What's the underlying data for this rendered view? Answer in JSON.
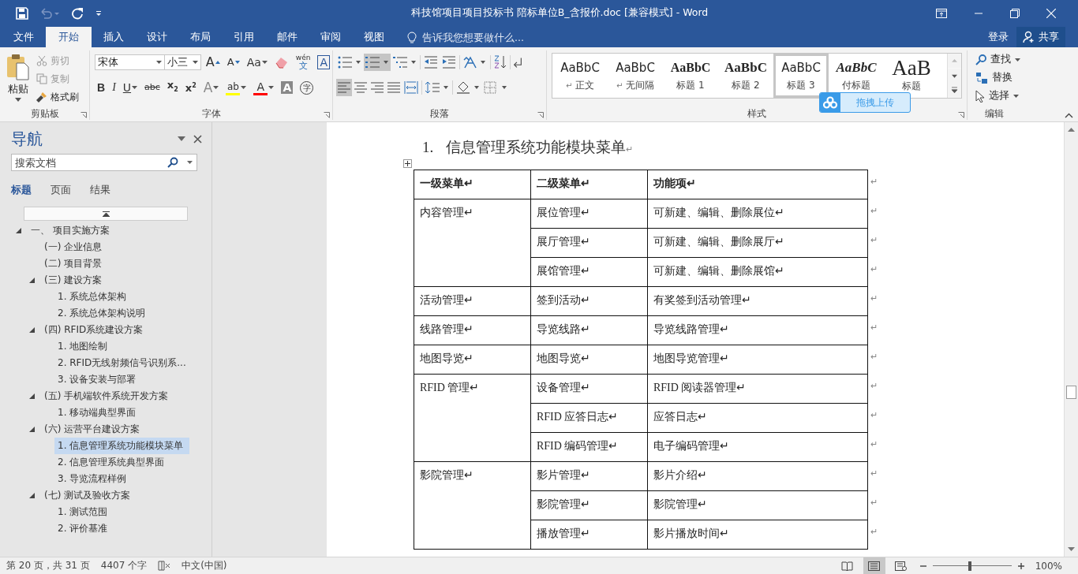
{
  "window": {
    "title": "科技馆项目项目投标书 陪标单位B_含报价.doc [兼容模式] - Word"
  },
  "tabs": [
    {
      "label": "文件",
      "selected": false
    },
    {
      "label": "开始",
      "selected": true
    },
    {
      "label": "插入",
      "selected": false
    },
    {
      "label": "设计",
      "selected": false
    },
    {
      "label": "布局",
      "selected": false
    },
    {
      "label": "引用",
      "selected": false
    },
    {
      "label": "邮件",
      "selected": false
    },
    {
      "label": "审阅",
      "selected": false
    },
    {
      "label": "视图",
      "selected": false
    }
  ],
  "tell_me": {
    "placeholder": "告诉我您想要做什么..."
  },
  "account": {
    "sign_in": "登录",
    "share": "共享"
  },
  "ribbon": {
    "clipboard": {
      "label": "剪贴板",
      "paste": "粘贴",
      "cut": "剪切",
      "copy": "复制",
      "format_painter": "格式刷"
    },
    "font": {
      "label": "字体",
      "font_name": "宋体",
      "font_size": "小三",
      "row1": [
        {
          "kind": "grow",
          "glyph": "A"
        },
        {
          "kind": "shrink",
          "glyph": "A"
        },
        {
          "kind": "case",
          "glyph": "Aa",
          "has_menu": true
        },
        {
          "kind": "clear"
        },
        {
          "kind": "phonetic",
          "glyph": "wén",
          "sub": "文"
        },
        {
          "kind": "border",
          "glyph": "A"
        }
      ],
      "row2": [
        {
          "kind": "bold",
          "glyph": "B"
        },
        {
          "kind": "italic",
          "glyph": "I"
        },
        {
          "kind": "underline",
          "glyph": "U",
          "has_menu": true
        },
        {
          "kind": "strike",
          "glyph": "abc"
        },
        {
          "kind": "subscript",
          "glyph": "x",
          "sub": "2"
        },
        {
          "kind": "superscript",
          "glyph": "x",
          "sup": "2"
        },
        {
          "kind": "effects",
          "glyph": "A",
          "has_menu": true
        },
        {
          "kind": "highlight",
          "glyph": "ab",
          "color": "#ffff00",
          "has_menu": true
        },
        {
          "kind": "color",
          "glyph": "A",
          "color": "#ff0000",
          "has_menu": true
        },
        {
          "kind": "shading",
          "glyph": "A"
        },
        {
          "kind": "enclose",
          "glyph": "字"
        }
      ]
    },
    "paragraph": {
      "label": "段落",
      "numbering_selected": true,
      "align_left_selected": true
    },
    "styles": {
      "label": "样式",
      "items": [
        {
          "sample": "AaBbC",
          "name": "正文",
          "mark": "↵",
          "kind": "normal",
          "selected": false
        },
        {
          "sample": "AaBbC",
          "name": "无间隔",
          "mark": "↵",
          "kind": "normal",
          "selected": false
        },
        {
          "sample": "AaBbC",
          "name": "标题 1",
          "kind": "heading1",
          "selected": false
        },
        {
          "sample": "AaBbC",
          "name": "标题 2",
          "kind": "heading2",
          "selected": false
        },
        {
          "sample": "AaBbC",
          "name": "标题 3",
          "kind": "normal",
          "selected": true
        },
        {
          "sample": "AaBbC",
          "name": "付标题",
          "kind": "subtitle",
          "selected": false
        },
        {
          "sample": "AaB",
          "name": "标题",
          "kind": "title",
          "selected": false
        }
      ]
    },
    "editing": {
      "label": "编辑",
      "find": "查找",
      "replace": "替换",
      "select": "选择"
    }
  },
  "upload_tooltip": "拖拽上传",
  "navigation": {
    "title": "导航",
    "search": {
      "placeholder": "搜索文档"
    },
    "tabs": [
      {
        "label": "标题",
        "selected": true
      },
      {
        "label": "页面",
        "selected": false
      },
      {
        "label": "结果",
        "selected": false
      }
    ],
    "tree": [
      {
        "label": "一、 项目实施方案",
        "expanded": true,
        "selected": false,
        "children": [
          {
            "label": "(一) 企业信息",
            "selected": false
          },
          {
            "label": "(二) 项目背景",
            "selected": false
          },
          {
            "label": "(三) 建设方案",
            "expanded": true,
            "selected": false,
            "children": [
              {
                "label": "1. 系统总体架构",
                "selected": false
              },
              {
                "label": "2. 系统总体架构说明",
                "selected": false
              }
            ]
          },
          {
            "label": "(四) RFID系统建设方案",
            "expanded": true,
            "selected": false,
            "children": [
              {
                "label": "1. 地图绘制",
                "selected": false
              },
              {
                "label": "2. RFID无线射频信号识别系...",
                "selected": false
              },
              {
                "label": "3. 设备安装与部署",
                "selected": false
              }
            ]
          },
          {
            "label": "(五) 手机端软件系统开发方案",
            "expanded": true,
            "selected": false,
            "children": [
              {
                "label": "1. 移动端典型界面",
                "selected": false
              }
            ]
          },
          {
            "label": "(六) 运营平台建设方案",
            "expanded": true,
            "selected": false,
            "children": [
              {
                "label": "1. 信息管理系统功能模块菜单",
                "selected": true
              },
              {
                "label": "2. 信息管理系统典型界面",
                "selected": false
              },
              {
                "label": "3. 导览流程样例",
                "selected": false
              }
            ]
          },
          {
            "label": "(七) 测试及验收方案",
            "expanded": true,
            "selected": false,
            "children": [
              {
                "label": "1. 测试范围",
                "selected": false
              },
              {
                "label": "2. 评价基准",
                "selected": false
              }
            ]
          }
        ]
      }
    ]
  },
  "document": {
    "heading_number": "1.",
    "heading": "信息管理系统功能模块菜单",
    "mark": "↵",
    "table": {
      "columns": [
        "一级菜单↵",
        "二级菜单↵",
        "功能项↵"
      ],
      "row_end_mark": "↵",
      "groups": [
        {
          "first": "内容管理↵",
          "rows": [
            {
              "second": "展位管理↵",
              "function": "可新建、编辑、删除展位↵"
            },
            {
              "second": "展厅管理↵",
              "function": "可新建、编辑、删除展厅↵"
            },
            {
              "second": "展馆管理↵",
              "function": "可新建、编辑、删除展馆↵"
            }
          ]
        },
        {
          "first": "活动管理↵",
          "rows": [
            {
              "second": "签到活动↵",
              "function": "有奖签到活动管理↵"
            }
          ]
        },
        {
          "first": "线路管理↵",
          "rows": [
            {
              "second": "导览线路↵",
              "function": "导览线路管理↵"
            }
          ]
        },
        {
          "first": "地图导览↵",
          "rows": [
            {
              "second": "地图导览↵",
              "function": "地图导览管理↵"
            }
          ]
        },
        {
          "first": "RFID 管理↵",
          "rows": [
            {
              "second": "设备管理↵",
              "function": "RFID 阅读器管理↵"
            },
            {
              "second": "RFID 应答日志↵",
              "function": "应答日志↵"
            },
            {
              "second": "RFID 编码管理↵",
              "function": "电子编码管理↵"
            }
          ]
        },
        {
          "first": "影院管理↵",
          "rows": [
            {
              "second": "影片管理↵",
              "function": "影片介绍↵"
            },
            {
              "second": "影院管理↵",
              "function": "影院管理↵"
            },
            {
              "second": "播放管理↵",
              "function": "影片播放时间↵"
            }
          ]
        }
      ]
    }
  },
  "status_bar": {
    "page": "第 20 页，共 31 页",
    "words": "4407 个字",
    "language": "中文(中国)",
    "zoom": "100%",
    "zoom_slider": {
      "level": 0.45
    },
    "views": [
      {
        "kind": "read",
        "selected": false
      },
      {
        "kind": "print",
        "selected": true
      },
      {
        "kind": "web",
        "selected": false
      }
    ]
  }
}
